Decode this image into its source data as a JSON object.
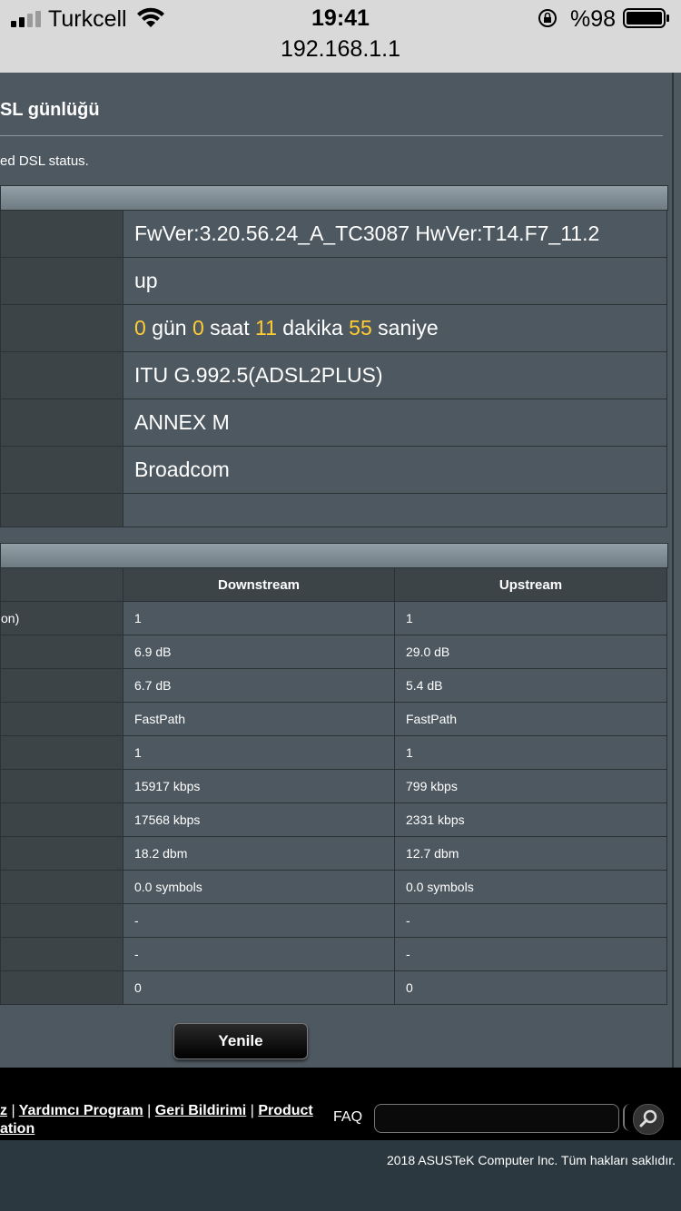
{
  "status_bar": {
    "carrier": "Turkcell",
    "time": "19:41",
    "battery": "%98",
    "url": "192.168.1.1"
  },
  "panel": {
    "title": "SL günlüğü",
    "description": "ed DSL status."
  },
  "info_rows": [
    {
      "value": "FwVer:3.20.56.24_A_TC3087 HwVer:T14.F7_11.2"
    },
    {
      "value": "up"
    },
    {
      "value": "ITU G.992.5(ADSL2PLUS)"
    },
    {
      "value": "ANNEX M"
    },
    {
      "value": "Broadcom"
    },
    {
      "value": ""
    }
  ],
  "uptime": {
    "days": "0",
    "days_unit": "gün",
    "hours": "0",
    "hours_unit": "saat",
    "minutes": "11",
    "minutes_unit": "dakika",
    "seconds": "55",
    "seconds_unit": "saniye"
  },
  "stats": {
    "headers": {
      "downstream": "Downstream",
      "upstream": "Upstream"
    },
    "rows": [
      {
        "label": "on)",
        "down": "1",
        "up": "1"
      },
      {
        "label": "",
        "down": "6.9 dB",
        "up": "29.0 dB"
      },
      {
        "label": "",
        "down": "6.7 dB",
        "up": "5.4 dB"
      },
      {
        "label": "",
        "down": "FastPath",
        "up": "FastPath"
      },
      {
        "label": "",
        "down": "1",
        "up": "1"
      },
      {
        "label": "",
        "down": "15917 kbps",
        "up": "799 kbps"
      },
      {
        "label": "",
        "down": "17568 kbps",
        "up": "2331 kbps"
      },
      {
        "label": "",
        "down": "18.2 dbm",
        "up": "12.7 dbm"
      },
      {
        "label": "",
        "down": "0.0 symbols",
        "up": "0.0 symbols"
      },
      {
        "label": "",
        "down": "-",
        "up": "-"
      },
      {
        "label": "",
        "down": "-",
        "up": "-"
      },
      {
        "label": "",
        "down": "0",
        "up": "0"
      }
    ]
  },
  "buttons": {
    "refresh": "Yenile"
  },
  "footer": {
    "link1": "z",
    "link2": "Yardımcı Program",
    "link3": "Geri Bildirimi",
    "link4a": "Product",
    "link4b": "ation",
    "separator": "|",
    "faq": "FAQ",
    "copyright": "2018 ASUSTeK Computer Inc. Tüm hakları saklıdır."
  },
  "colors": {
    "accent_yellow": "#ffcc33",
    "panel_bg": "#4d5860",
    "label_bg": "#3d4448"
  }
}
